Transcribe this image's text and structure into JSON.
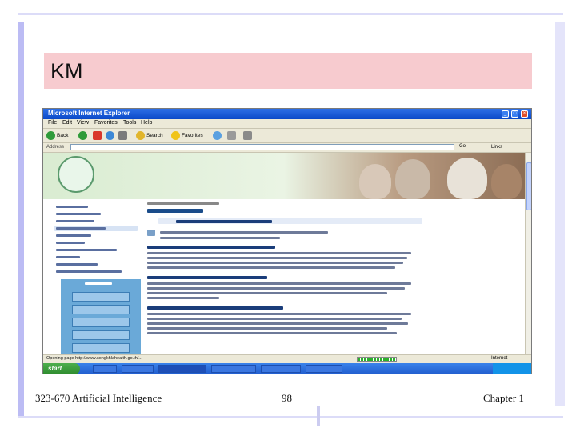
{
  "slide": {
    "title": "KM",
    "footer_left": "323-670 Artificial Intelligence",
    "footer_center": "98",
    "footer_right": "Chapter 1"
  },
  "browser": {
    "window_title": "Microsoft Internet Explorer",
    "menu": [
      "File",
      "Edit",
      "View",
      "Favorites",
      "Tools",
      "Help"
    ],
    "toolbar": {
      "back": "Back",
      "search": "Search",
      "favorites": "Favorites"
    },
    "address_label": "Address",
    "go_label": "Go",
    "links_label": "Links",
    "status_text": "Opening page http://www.songkhlahealth.go.th/...",
    "zone_label": "Internet",
    "start_label": "start",
    "colors": {
      "titlebar": "#0a48c8",
      "taskbar": "#215dce",
      "start": "#2e8b2e",
      "sidebar_panel": "#6aa9d8",
      "banner_green": "#1e6b3d"
    }
  }
}
